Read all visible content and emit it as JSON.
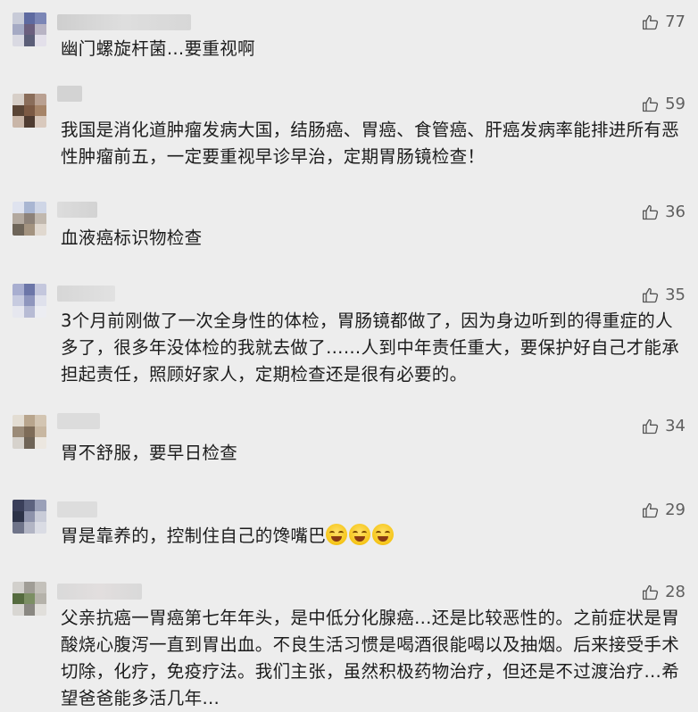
{
  "comments": [
    {
      "likes": "77",
      "text": "幽门螺旋杆菌…要重视啊"
    },
    {
      "likes": "59",
      "text": "我国是消化道肿瘤发病大国，结肠癌、胃癌、食管癌、肝癌发病率能排进所有恶性肿瘤前五，一定要重视早诊早治，定期胃肠镜检查！"
    },
    {
      "likes": "36",
      "text": "血液癌标识物检查"
    },
    {
      "likes": "35",
      "text": "3个月前刚做了一次全身性的体检，胃肠镜都做了，因为身边听到的得重症的人多了，很多年没体检的我就去做了……人到中年责任重大，要保护好自己才能承担起责任，照顾好家人，定期检查还是很有必要的。"
    },
    {
      "likes": "34",
      "text": "胃不舒服，要早日检查"
    },
    {
      "likes": "29",
      "text": "胃是靠养的，控制住自己的馋嘴巴",
      "emoji": [
        "laughing-tears-emoji",
        "laughing-tears-emoji",
        "laughing-tears-emoji"
      ]
    },
    {
      "likes": "28",
      "text": "父亲抗癌一胃癌第七年年头，是中低分化腺癌…还是比较恶性的。之前症状是胃酸烧心腹泻一直到胃出血。不良生活习惯是喝酒很能喝以及抽烟。后来接受手术切除，化疗，免疫疗法。我们主张，虽然积极药物治疗，但还是不过渡治疗…希望爸爸能多活几年…"
    }
  ],
  "icons": {
    "like": "thumbs-up-icon"
  },
  "colors": {
    "background": "#ededed",
    "text": "#1c1c1c",
    "likes": "#5f5f5f"
  }
}
